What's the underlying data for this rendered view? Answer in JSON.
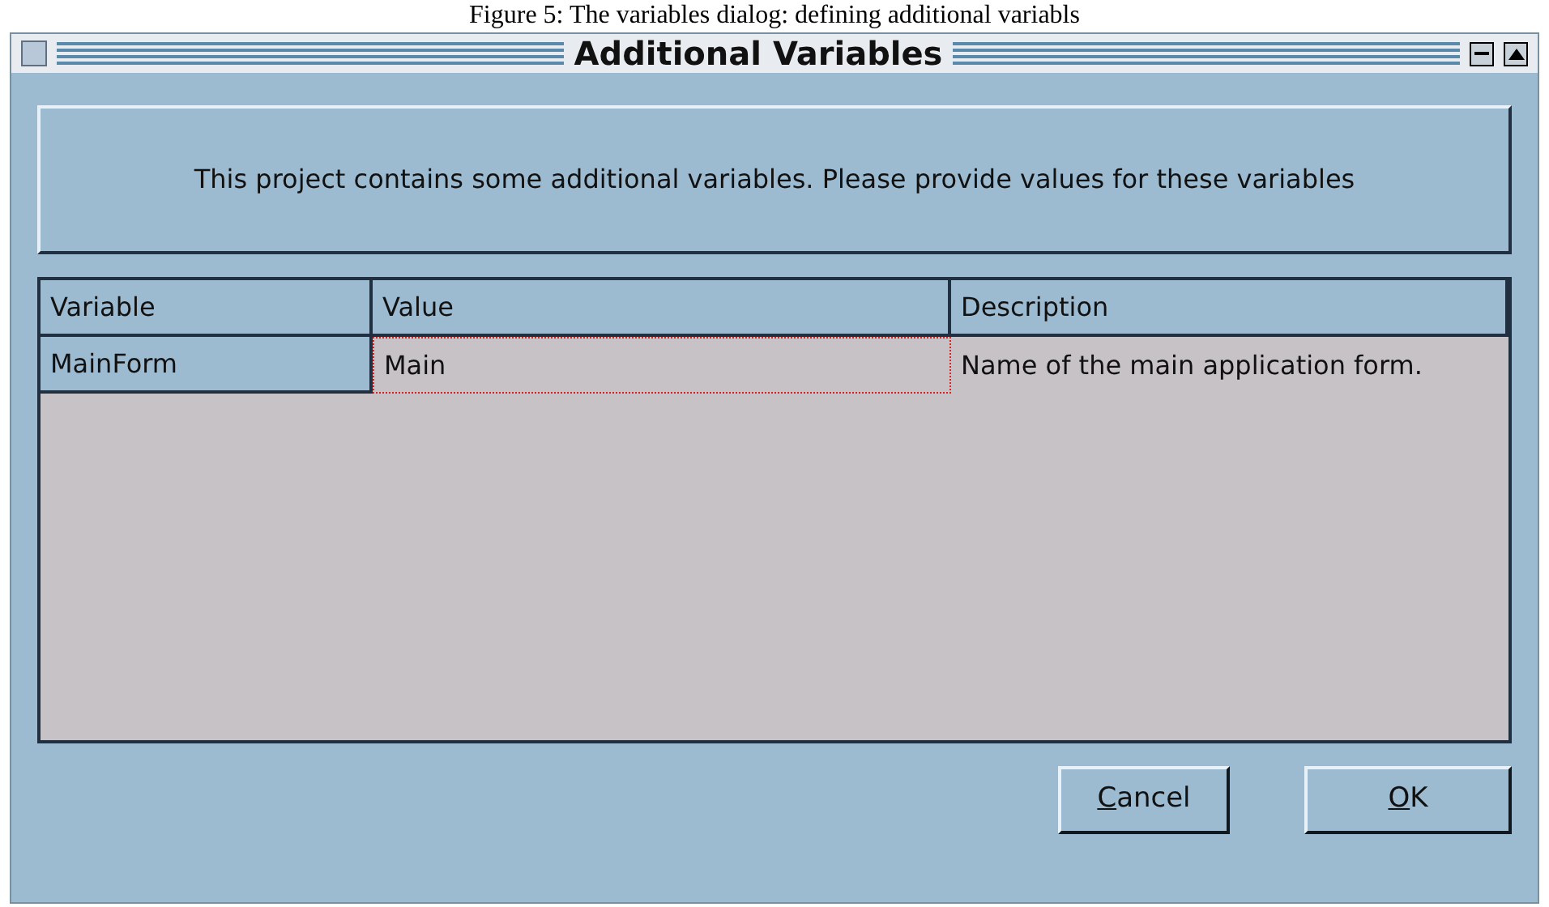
{
  "caption": "Figure 5: The variables dialog: defining additional variabls",
  "window": {
    "title": "Additional Variables"
  },
  "message": "This project contains some additional variables. Please provide values for these variables",
  "table": {
    "columns": [
      "Variable",
      "Value",
      "Description"
    ],
    "rows": [
      {
        "cells": [
          {
            "text": "MainForm",
            "focused": false
          },
          {
            "text": "Main",
            "focused": true
          },
          {
            "text": "Name of the main application form.",
            "focused": false
          }
        ]
      }
    ]
  },
  "buttons": [
    {
      "label": "Cancel"
    },
    {
      "label": "OK"
    }
  ]
}
